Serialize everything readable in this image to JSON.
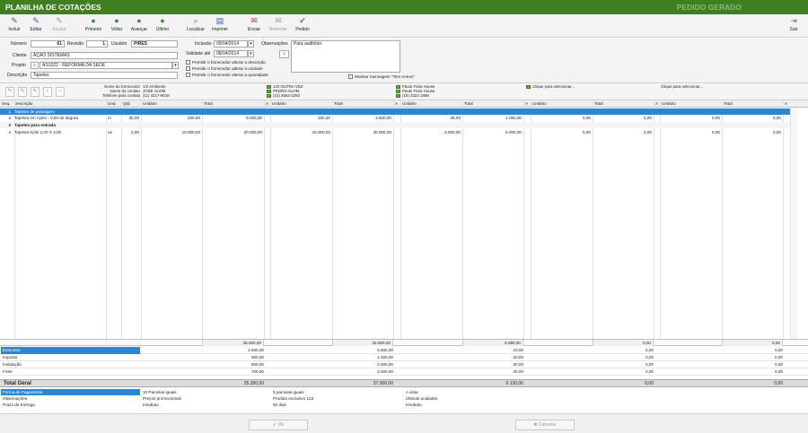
{
  "window": {
    "title": "PLANILHA DE COTAÇÕES",
    "status": "PEDIDO GERADO"
  },
  "toolbar": {
    "incluir": "Incluir",
    "editar": "Editar",
    "excluir": "Excluir",
    "primeiro": "Primeiro",
    "voltar": "Voltar",
    "avancar": "Avançar",
    "ultimo": "Último",
    "localizar": "Localizar",
    "imprimir": "Imprimir",
    "enviar": "Enviar",
    "reenviar": "Reenviar",
    "pedido": "Pedido",
    "sair": "Sair"
  },
  "form": {
    "numero_label": "Número",
    "numero": "61",
    "revisao_label": "Revisão",
    "revisao": "1",
    "usuario_label": "Usuário",
    "usuario": "PIRES",
    "cliente_label": "Cliente",
    "cliente": "AÇÃO SISTEMAS",
    "projeto_label": "Projeto",
    "projeto": "AS1022 - REFORMA DA SEDE",
    "descricao_label": "Descrição",
    "descricao": "Tapetes",
    "inclusao_label": "Inclusão",
    "inclusao": "05/04/2014",
    "validade_label": "Validade até",
    "validade": "08/04/2014",
    "obs_label": "Observações",
    "obs": "Para auditório",
    "check1": "Permitir o fornecedor alterar a descrição",
    "check2": "Permitir o fornecedor alterar a unidade",
    "check3": "Permitir o fornecedor alterar a quantidade",
    "mostrar": "Mostrar mensagem \"Tem Anexo\""
  },
  "suppliers": {
    "labels": {
      "nome": "Nome do fornecedor",
      "contato": "Nome do contato",
      "telefone": "Telefone para contato"
    },
    "primary": {
      "nome": "1/2 Ambiente",
      "contato": "JOSÉ ALVIM",
      "telefone": "(11) 3217-9018"
    },
    "s1": {
      "l1": "123 OUTRA VEZ",
      "l2": "PEDRO ALVIM",
      "l3": "(21) 3662-2292"
    },
    "s2": {
      "l1": "Paulo Faria House",
      "l2": "Paulo Faria House",
      "l3": "(18) 3323 1888"
    },
    "s3": {
      "l1": "Clique para selecionar..."
    },
    "s4": {
      "l1": "Clique para selecionar..."
    }
  },
  "grid": {
    "headers": {
      "seq": "Seq.",
      "descricao": "Descrição",
      "und": "Und.",
      "qtd": "Qtd.",
      "unitario": "Unitário",
      "total": "Total",
      "a": "A"
    },
    "rows": [
      {
        "seq": "1",
        "descricao": "Tapetes de passagem",
        "und": "",
        "qtd": "",
        "c1u": "",
        "c1t": "",
        "c2u": "",
        "c2t": "",
        "c3u": "",
        "c3t": "",
        "c4u": "",
        "c4t": "",
        "c5u": "",
        "c5t": ""
      },
      {
        "seq": "2",
        "descricao": "Tapetes em nylon - 0,50 de largura",
        "und": "m",
        "qtd": "30,00",
        "c1u": "200,00",
        "c1t": "6.000,00",
        "c2u": "150,00",
        "c2t": "4.500,00",
        "c3u": "35,00",
        "c3t": "1.050,00",
        "c4u": "0,00",
        "c4t": "0,00",
        "c5u": "0,00",
        "c5t": "0,00"
      },
      {
        "seq": "3",
        "descricao": "Tapetes para entrada",
        "und": "",
        "qtd": "",
        "c1u": "",
        "c1t": "",
        "c2u": "",
        "c2t": "",
        "c3u": "",
        "c3t": "",
        "c4u": "",
        "c4t": "",
        "c5u": "",
        "c5t": ""
      },
      {
        "seq": "4",
        "descricao": "Tapetes Kylin 2,00 X 3,00",
        "und": "un",
        "qtd": "2,00",
        "c1u": "10.000,00",
        "c1t": "20.000,00",
        "c2u": "15.000,00",
        "c2t": "30.000,00",
        "c3u": "2.500,00",
        "c3t": "5.000,00",
        "c4u": "0,00",
        "c4t": "0,00",
        "c5u": "0,00",
        "c5t": "0,00"
      }
    ],
    "totals": [
      "26.000,00",
      "34.500,00",
      "6.050,00",
      "0,00",
      "0,00"
    ]
  },
  "extras": [
    {
      "label": "Desconto",
      "values": [
        "1.500,00",
        "5.500,00",
        "10,00",
        "0,00",
        "0,00"
      ]
    },
    {
      "label": "Imposto",
      "values": [
        "500,00",
        "1.000,00",
        "20,00",
        "0,00",
        "0,00"
      ]
    },
    {
      "label": "Instalação",
      "values": [
        "600,00",
        "2.000,00",
        "30,00",
        "0,00",
        "0,00"
      ]
    },
    {
      "label": "Frete",
      "values": [
        "700,00",
        "3.000,00",
        "40,00",
        "0,00",
        "0,00"
      ]
    }
  ],
  "total_geral": {
    "label": "Total Geral",
    "values": [
      "25.300,00",
      "37.000,00",
      "6.130,00",
      "0,00",
      "0,00"
    ]
  },
  "conditions": [
    {
      "label": "Forma de Pagamento",
      "values": [
        "10 Parcelas iguais",
        "5 parcelas iguais",
        "A vista",
        "",
        ""
      ]
    },
    {
      "label": "Observações",
      "values": [
        "Preços promocionais",
        "Produto exclusivo 123",
        "Últimas unidades",
        "",
        ""
      ]
    },
    {
      "label": "Prazo de Entrega",
      "values": [
        "Imediato",
        "60 dias",
        "Imediato",
        "",
        ""
      ]
    }
  ],
  "buttons": {
    "ok": "Ok",
    "cancelar": "Cancelar"
  },
  "colors": {
    "title_bar": "#3e7f22",
    "selection": "#2a86d6"
  }
}
